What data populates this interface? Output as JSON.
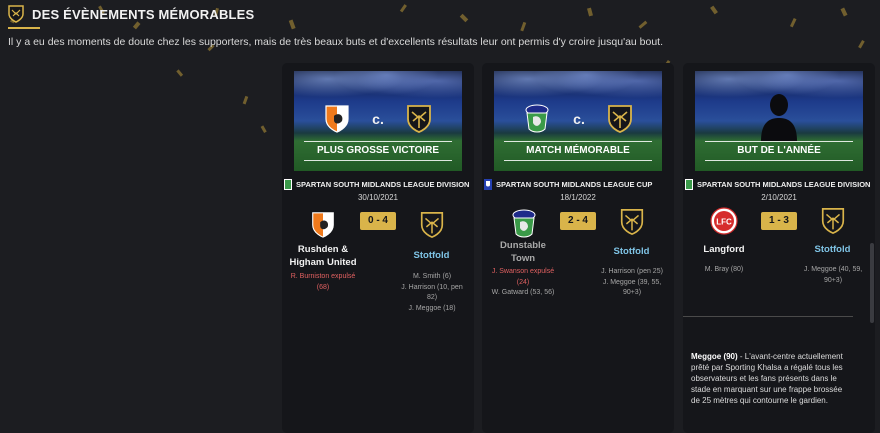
{
  "header": {
    "title": "DES ÉVÈNEMENTS MÉMORABLES",
    "intro": "Il y a eu des moments de doute chez les supporters, mais de très beaux buts et d'excellents résultats leur ont permis d'y croire jusqu'au bout."
  },
  "cards": [
    {
      "banner_title": "PLUS GROSSE VICTOIRE",
      "vs": "c.",
      "competition": "SPARTAN SOUTH MIDLANDS LEAGUE DIVISION",
      "date": "30/10/2021",
      "score": "0 - 4",
      "home_name": "Rushden & Higham United",
      "away_name": "Stotfold",
      "home_events": [
        "R. Burniston expulsé",
        "(68)"
      ],
      "away_events": [
        "M. Smith (6)",
        "J. Harrison (10, pen",
        "82)",
        "J. Meggoe (18)"
      ]
    },
    {
      "banner_title": "MATCH MÉMORABLE",
      "vs": "c.",
      "competition": "SPARTAN SOUTH MIDLANDS LEAGUE CUP",
      "date": "18/1/2022",
      "score": "2 - 4",
      "home_name": "Dunstable Town",
      "away_name": "Stotfold",
      "home_events_red": [
        "J. Swanson expulsé",
        "(24)"
      ],
      "home_events": [
        "W. Gatward (53, 56)"
      ],
      "away_events": [
        "J. Harrison (pen 25)",
        "J. Meggoe (39, 55,",
        "90+3)"
      ]
    },
    {
      "banner_title": "BUT DE L'ANNÉE",
      "competition": "SPARTAN SOUTH MIDLANDS LEAGUE DIVISION",
      "date": "2/10/2021",
      "score": "1 - 3",
      "home_name": "Langford",
      "away_name": "Stotfold",
      "home_logo_text": "LFC",
      "home_events": [
        "M. Bray (80)"
      ],
      "away_events": [
        "J. Meggoe (40, 59,",
        "90+3)"
      ],
      "description_name": "Meggoe (90)",
      "description": " - L'avant-centre actuellement prêté par Sporting Khalsa a régalé tous les observateurs et les fans présents dans le stade en marquant sur une frappe brossée de 25 mètres qui contourne le gardien."
    }
  ],
  "colors": {
    "accent": "#d9b44a",
    "away_team": "#7fc4e6",
    "red_card": "#e06060",
    "background": "#1c1d21",
    "card": "#15161a"
  }
}
